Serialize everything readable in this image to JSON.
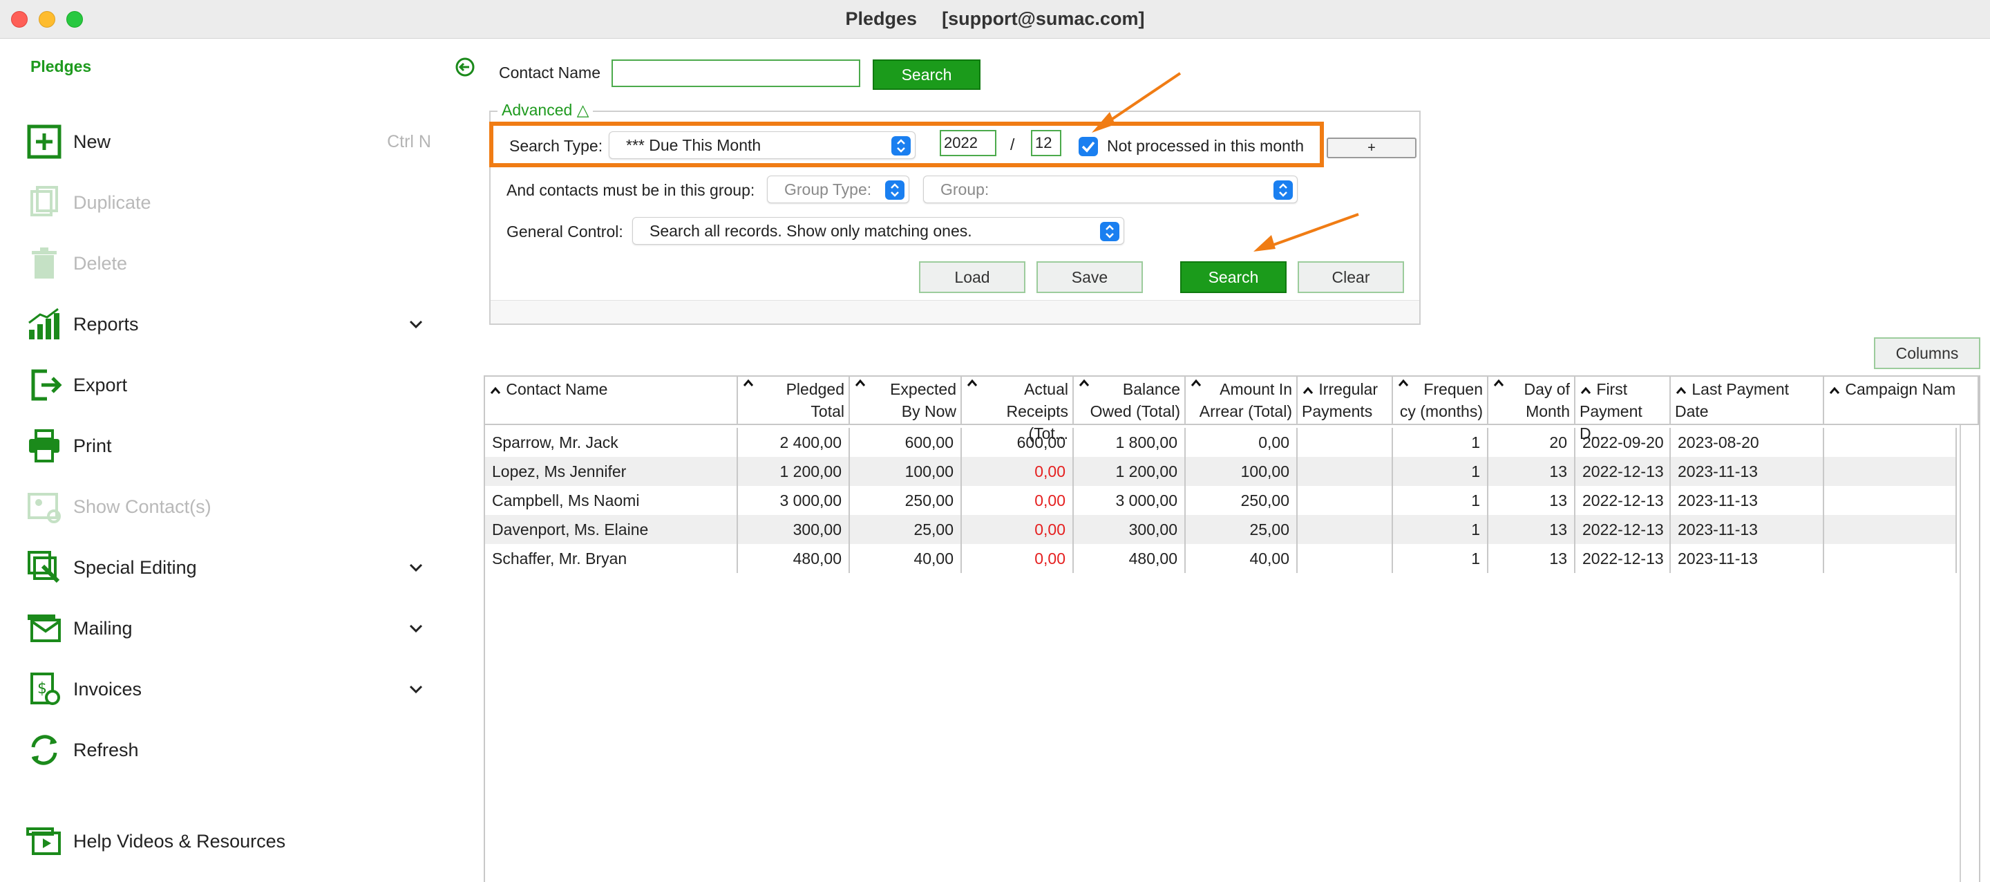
{
  "window": {
    "title": "Pledges",
    "account": "[support@sumac.com]"
  },
  "sidebar": {
    "header": "Pledges",
    "items": [
      {
        "label": "New",
        "shortcut": "Ctrl N",
        "icon": "plus-square-icon",
        "enabled": true
      },
      {
        "label": "Duplicate",
        "icon": "duplicate-icon",
        "enabled": false
      },
      {
        "label": "Delete",
        "icon": "trash-icon",
        "enabled": false
      },
      {
        "label": "Reports",
        "icon": "bar-chart-icon",
        "enabled": true,
        "expandable": true
      },
      {
        "label": "Export",
        "icon": "export-icon",
        "enabled": true
      },
      {
        "label": "Print",
        "icon": "printer-icon",
        "enabled": true
      },
      {
        "label": "Show Contact(s)",
        "icon": "contacts-icon",
        "enabled": false
      },
      {
        "label": "Special Editing",
        "icon": "special-editing-icon",
        "enabled": true,
        "expandable": true
      },
      {
        "label": "Mailing",
        "icon": "mail-icon",
        "enabled": true,
        "expandable": true
      },
      {
        "label": "Invoices",
        "icon": "invoice-icon",
        "enabled": true,
        "expandable": true
      },
      {
        "label": "Refresh",
        "icon": "refresh-icon",
        "enabled": true
      },
      {
        "label": "Help Videos & Resources",
        "icon": "video-icon",
        "enabled": true
      }
    ]
  },
  "search": {
    "contact_label": "Contact Name",
    "contact_value": "",
    "search_button": "Search"
  },
  "advanced": {
    "legend": "Advanced △",
    "search_type_label": "Search Type:",
    "search_type_value": "*** Due This Month",
    "year": "2022",
    "separator": "/",
    "month": "12",
    "not_processed_checked": true,
    "not_processed_label": "Not processed in this month",
    "plus_button": "+",
    "group_label": "And contacts must be in this group:",
    "group_type_placeholder": "Group Type:",
    "group_placeholder": "Group:",
    "general_control_label": "General Control:",
    "general_control_value": "Search all records. Show only matching ones.",
    "load_button": "Load",
    "save_button": "Save",
    "search_button": "Search",
    "clear_button": "Clear"
  },
  "columns_button": "Columns",
  "table": {
    "headers": [
      {
        "line1": "Contact Name",
        "line2": ""
      },
      {
        "line1": "Pledged",
        "line2": "Total"
      },
      {
        "line1": "Expected",
        "line2": "By Now"
      },
      {
        "line1": "Actual",
        "line2": "Receipts (Tot..."
      },
      {
        "line1": "Balance",
        "line2": "Owed (Total)"
      },
      {
        "line1": "Amount In",
        "line2": "Arrear (Total)"
      },
      {
        "line1": "Irregular",
        "line2": "Payments"
      },
      {
        "line1": "Frequen",
        "line2": "cy (months)"
      },
      {
        "line1": "Day of",
        "line2": "Month"
      },
      {
        "line1": "First",
        "line2": "Payment D..."
      },
      {
        "line1": "Last Payment",
        "line2": "Date"
      },
      {
        "line1": "Campaign Nam",
        "line2": ""
      }
    ],
    "rows": [
      {
        "name": "Sparrow, Mr. Jack",
        "pledged": "2 400,00",
        "expected": "600,00",
        "actual": "600,00",
        "actual_zero": false,
        "balance": "1 800,00",
        "arrear": "0,00",
        "irregular": "",
        "freq": "1",
        "day": "20",
        "first": "2022-09-20",
        "last": "2023-08-20",
        "campaign": ""
      },
      {
        "name": "Lopez, Ms Jennifer",
        "pledged": "1 200,00",
        "expected": "100,00",
        "actual": "0,00",
        "actual_zero": true,
        "balance": "1 200,00",
        "arrear": "100,00",
        "irregular": "",
        "freq": "1",
        "day": "13",
        "first": "2022-12-13",
        "last": "2023-11-13",
        "campaign": ""
      },
      {
        "name": "Campbell, Ms Naomi",
        "pledged": "3 000,00",
        "expected": "250,00",
        "actual": "0,00",
        "actual_zero": true,
        "balance": "3 000,00",
        "arrear": "250,00",
        "irregular": "",
        "freq": "1",
        "day": "13",
        "first": "2022-12-13",
        "last": "2023-11-13",
        "campaign": ""
      },
      {
        "name": "Davenport, Ms. Elaine",
        "pledged": "300,00",
        "expected": "25,00",
        "actual": "0,00",
        "actual_zero": true,
        "balance": "300,00",
        "arrear": "25,00",
        "irregular": "",
        "freq": "1",
        "day": "13",
        "first": "2022-12-13",
        "last": "2023-11-13",
        "campaign": ""
      },
      {
        "name": "Schaffer, Mr. Bryan",
        "pledged": "480,00",
        "expected": "40,00",
        "actual": "0,00",
        "actual_zero": true,
        "balance": "480,00",
        "arrear": "40,00",
        "irregular": "",
        "freq": "1",
        "day": "13",
        "first": "2022-12-13",
        "last": "2023-11-13",
        "campaign": ""
      }
    ]
  },
  "colors": {
    "accent": "#1b9b1b",
    "highlight": "#f07c14",
    "negative": "#e52020",
    "select_blue": "#1a7ff0"
  }
}
